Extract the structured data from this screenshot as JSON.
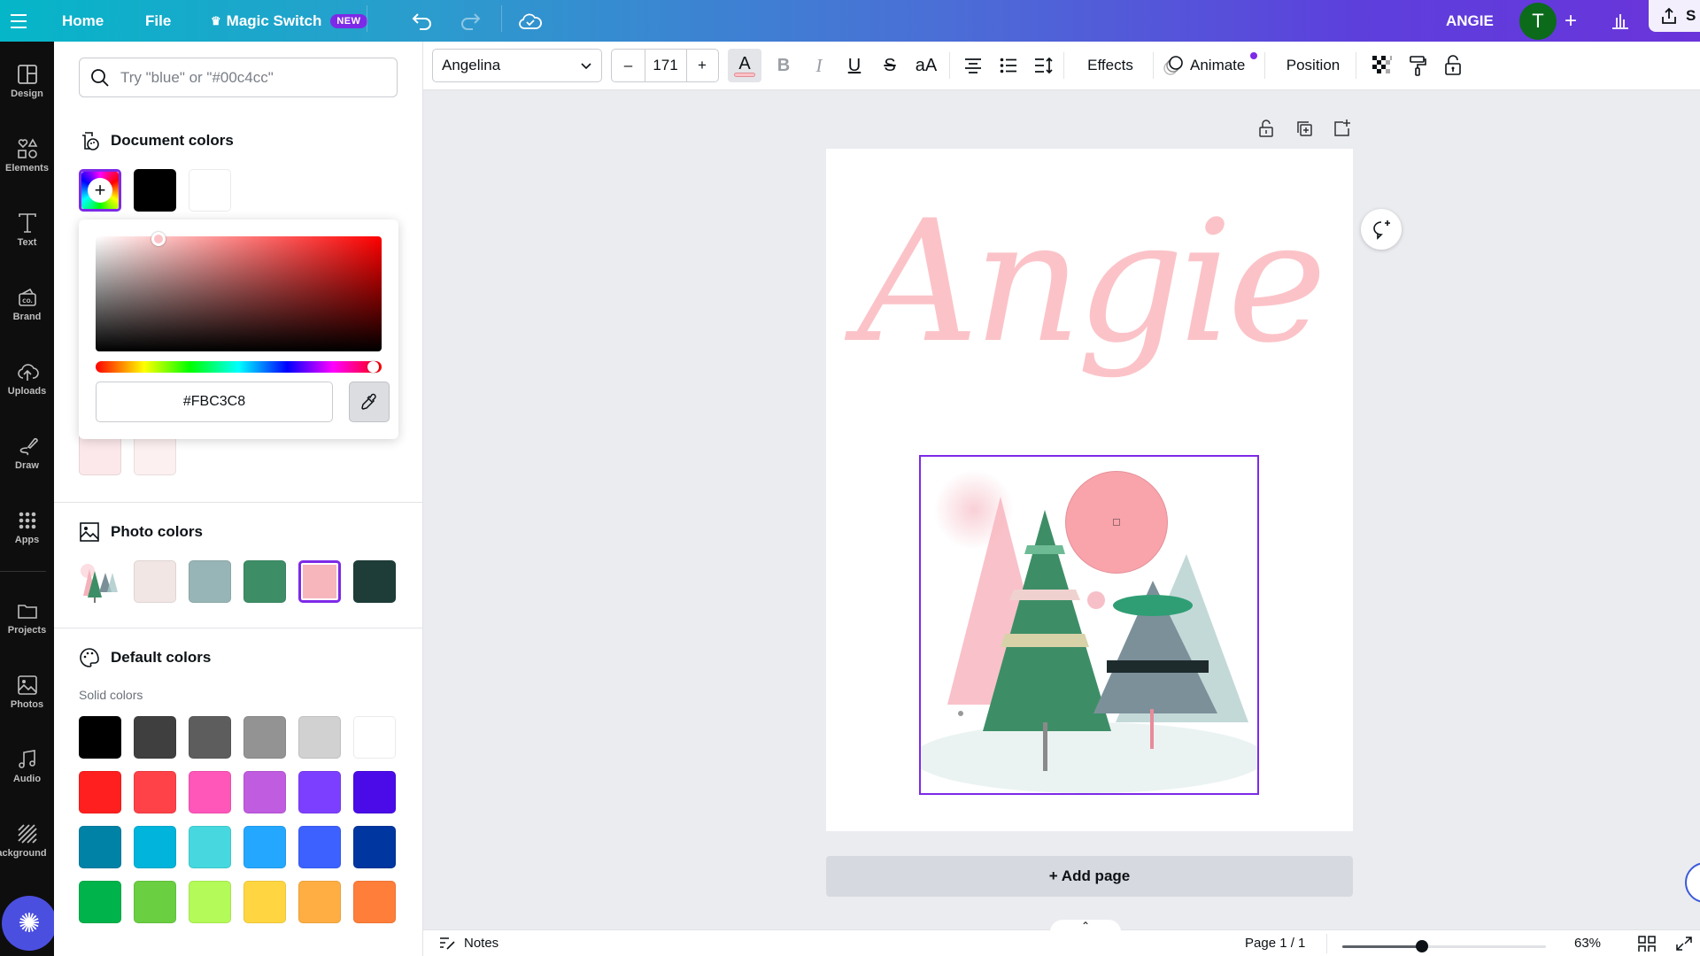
{
  "topbar": {
    "home": "Home",
    "file": "File",
    "magic_switch": "Magic Switch",
    "new_badge": "NEW",
    "design_title": "ANGIE",
    "avatar_initial": "T",
    "share_label": "S"
  },
  "rail": [
    {
      "id": "design",
      "label": "Design",
      "icon": "layout-icon"
    },
    {
      "id": "elements",
      "label": "Elements",
      "icon": "shapes-icon"
    },
    {
      "id": "text",
      "label": "Text",
      "icon": "text-icon"
    },
    {
      "id": "brand",
      "label": "Brand",
      "icon": "brand-icon"
    },
    {
      "id": "uploads",
      "label": "Uploads",
      "icon": "cloud-upload-icon"
    },
    {
      "id": "draw",
      "label": "Draw",
      "icon": "draw-icon"
    },
    {
      "id": "apps",
      "label": "Apps",
      "icon": "grid-icon"
    },
    {
      "id": "projects",
      "label": "Projects",
      "icon": "folder-icon"
    },
    {
      "id": "photos",
      "label": "Photos",
      "icon": "image-icon"
    },
    {
      "id": "audio",
      "label": "Audio",
      "icon": "music-icon"
    },
    {
      "id": "background",
      "label": "Background",
      "icon": "background-icon"
    }
  ],
  "panel": {
    "search_placeholder": "Try \"blue\" or \"#00c4cc\"",
    "document_colors_title": "Document colors",
    "document_colors": [
      "#000000",
      "#FFFFFF"
    ],
    "document_colors_extra": [
      "#FCE8EA",
      "#FDF0F1"
    ],
    "photo_colors_title": "Photo colors",
    "photo_colors": [
      "#F2E6E5",
      "#97B5B6",
      "#3D8E66",
      "#F7B6BC",
      "#1E3D38"
    ],
    "photo_colors_selected_index": 3,
    "default_colors_title": "Default colors",
    "solid_colors_label": "Solid colors",
    "solid_colors": [
      "#000000",
      "#3F3F3F",
      "#5D5D5D",
      "#939393",
      "#D1D1D1",
      "#FFFFFF",
      "#FF1F1F",
      "#FF4148",
      "#FF56BA",
      "#C05CE0",
      "#7D3FFF",
      "#4A0BE8",
      "#0082A6",
      "#00B4DB",
      "#46D8DE",
      "#24A8FF",
      "#3D61FF",
      "#0036A0",
      "#00B34B",
      "#6ACF41",
      "#B4FA58",
      "#FFD641",
      "#FFAE43",
      "#FF7E3A"
    ]
  },
  "picker": {
    "hex": "#FBC3C8",
    "saturation": 0.22,
    "brightness": 0.98,
    "hue_fraction": 0.98
  },
  "toolbar": {
    "font": "Angelina",
    "font_size": "171",
    "minus": "–",
    "plus": "+",
    "text_color": "#FBC3C8",
    "effects": "Effects",
    "animate": "Animate",
    "position": "Position"
  },
  "canvas": {
    "title_text": "Angie",
    "title_color": "#FBC3C8",
    "add_page": "+ Add page"
  },
  "bottombar": {
    "notes": "Notes",
    "page_indicator": "Page 1 / 1",
    "zoom_percent": "63%",
    "zoom_fraction": 0.39
  }
}
